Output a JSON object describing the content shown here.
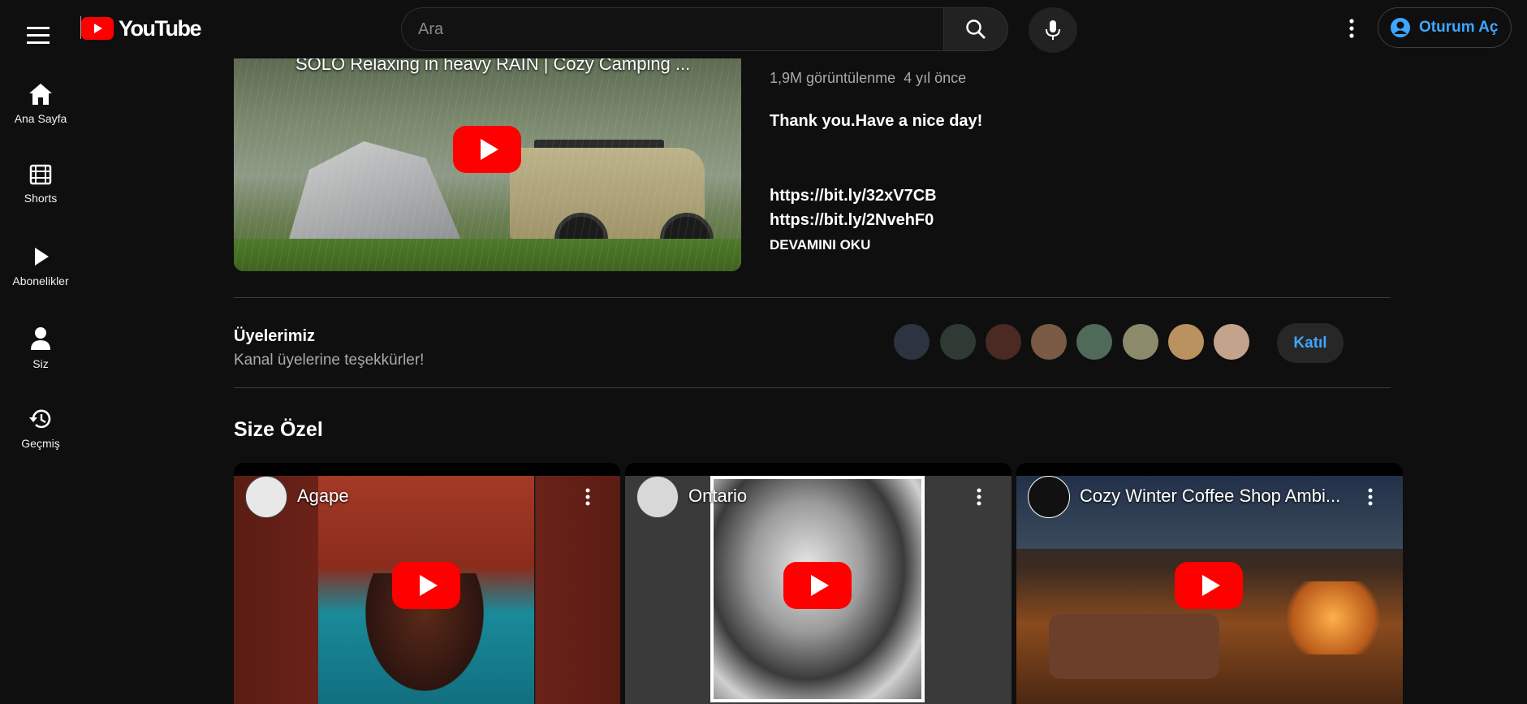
{
  "topbar": {
    "logo_text": "YouTube",
    "search_placeholder": "Ara",
    "signin_label": "Oturum Aç"
  },
  "sidebar": {
    "items": [
      {
        "label": "Ana Sayfa",
        "icon": "home-icon"
      },
      {
        "label": "Shorts",
        "icon": "shorts-icon"
      },
      {
        "label": "Abonelikler",
        "icon": "subscriptions-icon"
      },
      {
        "label": "Siz",
        "icon": "user-icon"
      },
      {
        "label": "Geçmiş",
        "icon": "history-icon"
      }
    ]
  },
  "featured": {
    "overlay_title": "SOLO Relaxing in heavy RAIN | Cozy Camping ...",
    "views": "1,9M görüntülenme",
    "age": "4 yıl önce",
    "description": [
      "Thank you.Have a nice day!",
      "https://bit.ly/32xV7CB",
      "https://bit.ly/2NvehF0"
    ],
    "read_more": "DEVAMINI OKU"
  },
  "members": {
    "title": "Üyelerimiz",
    "subtitle": "Kanal üyelerine teşekkürler!",
    "join_label": "Katıl",
    "avatar_colors": [
      "#2d3440",
      "#2e3a33",
      "#4a2a22",
      "#7a5a44",
      "#4f6a58",
      "#8b8a6a",
      "#b9925f",
      "#c4a38c"
    ]
  },
  "for_you": {
    "title": "Size Özel",
    "cards": [
      {
        "title": "Agape"
      },
      {
        "title": "Ontario"
      },
      {
        "title": "Cozy Winter Coffee Shop Ambi..."
      }
    ]
  },
  "colors": {
    "background": "#0f0f0f",
    "accent_blue": "#3ea6ff",
    "play_red": "#ff0000"
  }
}
